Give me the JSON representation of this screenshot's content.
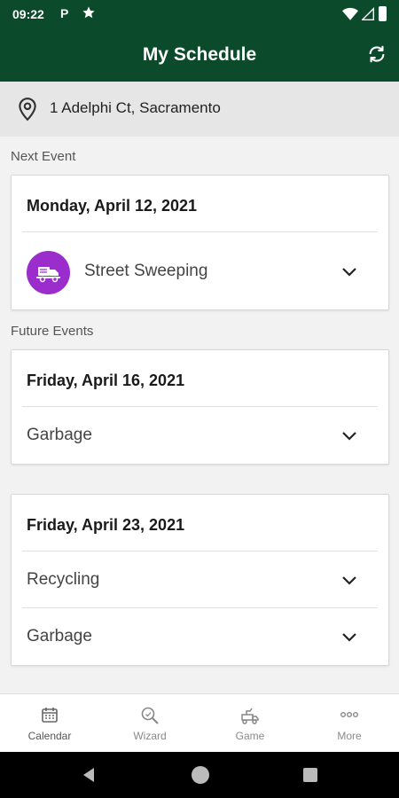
{
  "status_bar": {
    "time": "09:22",
    "parking_glyph": "P",
    "icons": [
      "star-icon",
      "wifi-icon",
      "signal-icon",
      "battery-icon"
    ]
  },
  "header": {
    "title": "My Schedule",
    "refresh_icon": "refresh-icon"
  },
  "location": {
    "address": "1 Adelphi Ct, Sacramento",
    "icon": "pin-icon"
  },
  "next_event": {
    "label": "Next Event",
    "date": "Monday, April 12, 2021",
    "events": [
      {
        "name": "Street Sweeping",
        "icon": "sweeper-truck-icon",
        "icon_color": "#9b2dcc"
      }
    ]
  },
  "future_events": {
    "label": "Future Events",
    "cards": [
      {
        "date": "Friday, April 16, 2021",
        "events": [
          {
            "name": "Garbage"
          }
        ]
      },
      {
        "date": "Friday, April 23, 2021",
        "events": [
          {
            "name": "Recycling"
          },
          {
            "name": "Garbage"
          }
        ]
      }
    ]
  },
  "bottom_nav": [
    {
      "label": "Calendar",
      "icon": "calendar-icon",
      "active": true
    },
    {
      "label": "Wizard",
      "icon": "search-icon",
      "active": false
    },
    {
      "label": "Game",
      "icon": "game-truck-icon",
      "active": false
    },
    {
      "label": "More",
      "icon": "more-dots-icon",
      "active": false
    }
  ],
  "colors": {
    "brand": "#0b4a2a",
    "event_icon": "#9b2dcc"
  }
}
